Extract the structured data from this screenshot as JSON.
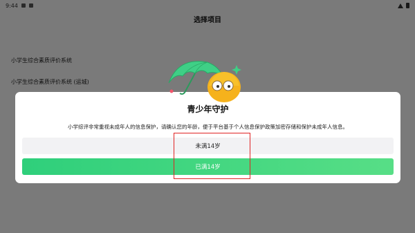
{
  "status_bar": {
    "time": "9:44",
    "left_icons": [
      "image-icon",
      "sim-card-icon"
    ],
    "right_icons": [
      "wifi-icon",
      "battery-icon"
    ]
  },
  "page": {
    "title": "选择项目",
    "items": [
      {
        "label": "小学生综合素质评价系统"
      },
      {
        "label": "小学生综合素质评价系统 (运城)"
      }
    ]
  },
  "dialog": {
    "title": "青少年守护",
    "description": "小学综评非常重视未成年人的信息保护，请确认您的年龄，便于平台基于个人信息保护政策加密存储和保护未成年人信息。",
    "under14_label": "未满14岁",
    "over14_label": "已满14岁",
    "mascot": "umbrella-mascot-illustration"
  },
  "colors": {
    "overlay": "rgba(0,0,0,0.5)",
    "primary_green": "#3ad57f",
    "highlight_red": "#e02222"
  }
}
